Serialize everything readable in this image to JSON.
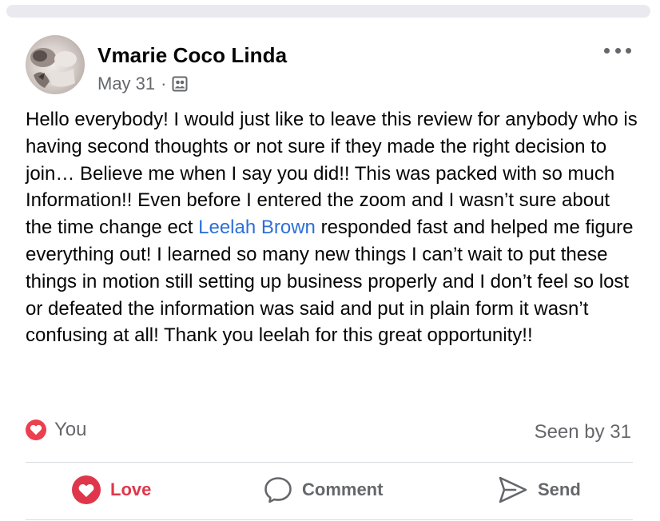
{
  "post": {
    "author": "Vmarie Coco Linda",
    "date": "May 31",
    "separator": "·",
    "audience_icon": "group-members-icon",
    "more_icon": "more-horizontal-icon",
    "body_part1": "Hello everybody! I would just like to leave this review for anybody who is having second thoughts or not sure if they made the right decision to join… Believe me when I say you did!! This was packed with so much Information!! Even before I entered the zoom and I wasn’t sure about the time change ect ",
    "mention": "Leelah Brown",
    "body_part2": " responded fast and helped me figure everything out! I learned so many new things I can’t wait to put these things in motion still setting up business properly and I don’t feel so lost or defeated the information was said and put in plain form it wasn’t confusing at all! Thank you leelah for this great opportunity!!"
  },
  "reactions": {
    "reactor": "You",
    "reaction_icon": "love-reaction-icon",
    "seen_by": "Seen by 31"
  },
  "actions": {
    "love": "Love",
    "comment": "Comment",
    "send": "Send"
  },
  "colors": {
    "love": "#e0364b",
    "mention": "#2e6fd9",
    "secondary_text": "#65676b"
  }
}
